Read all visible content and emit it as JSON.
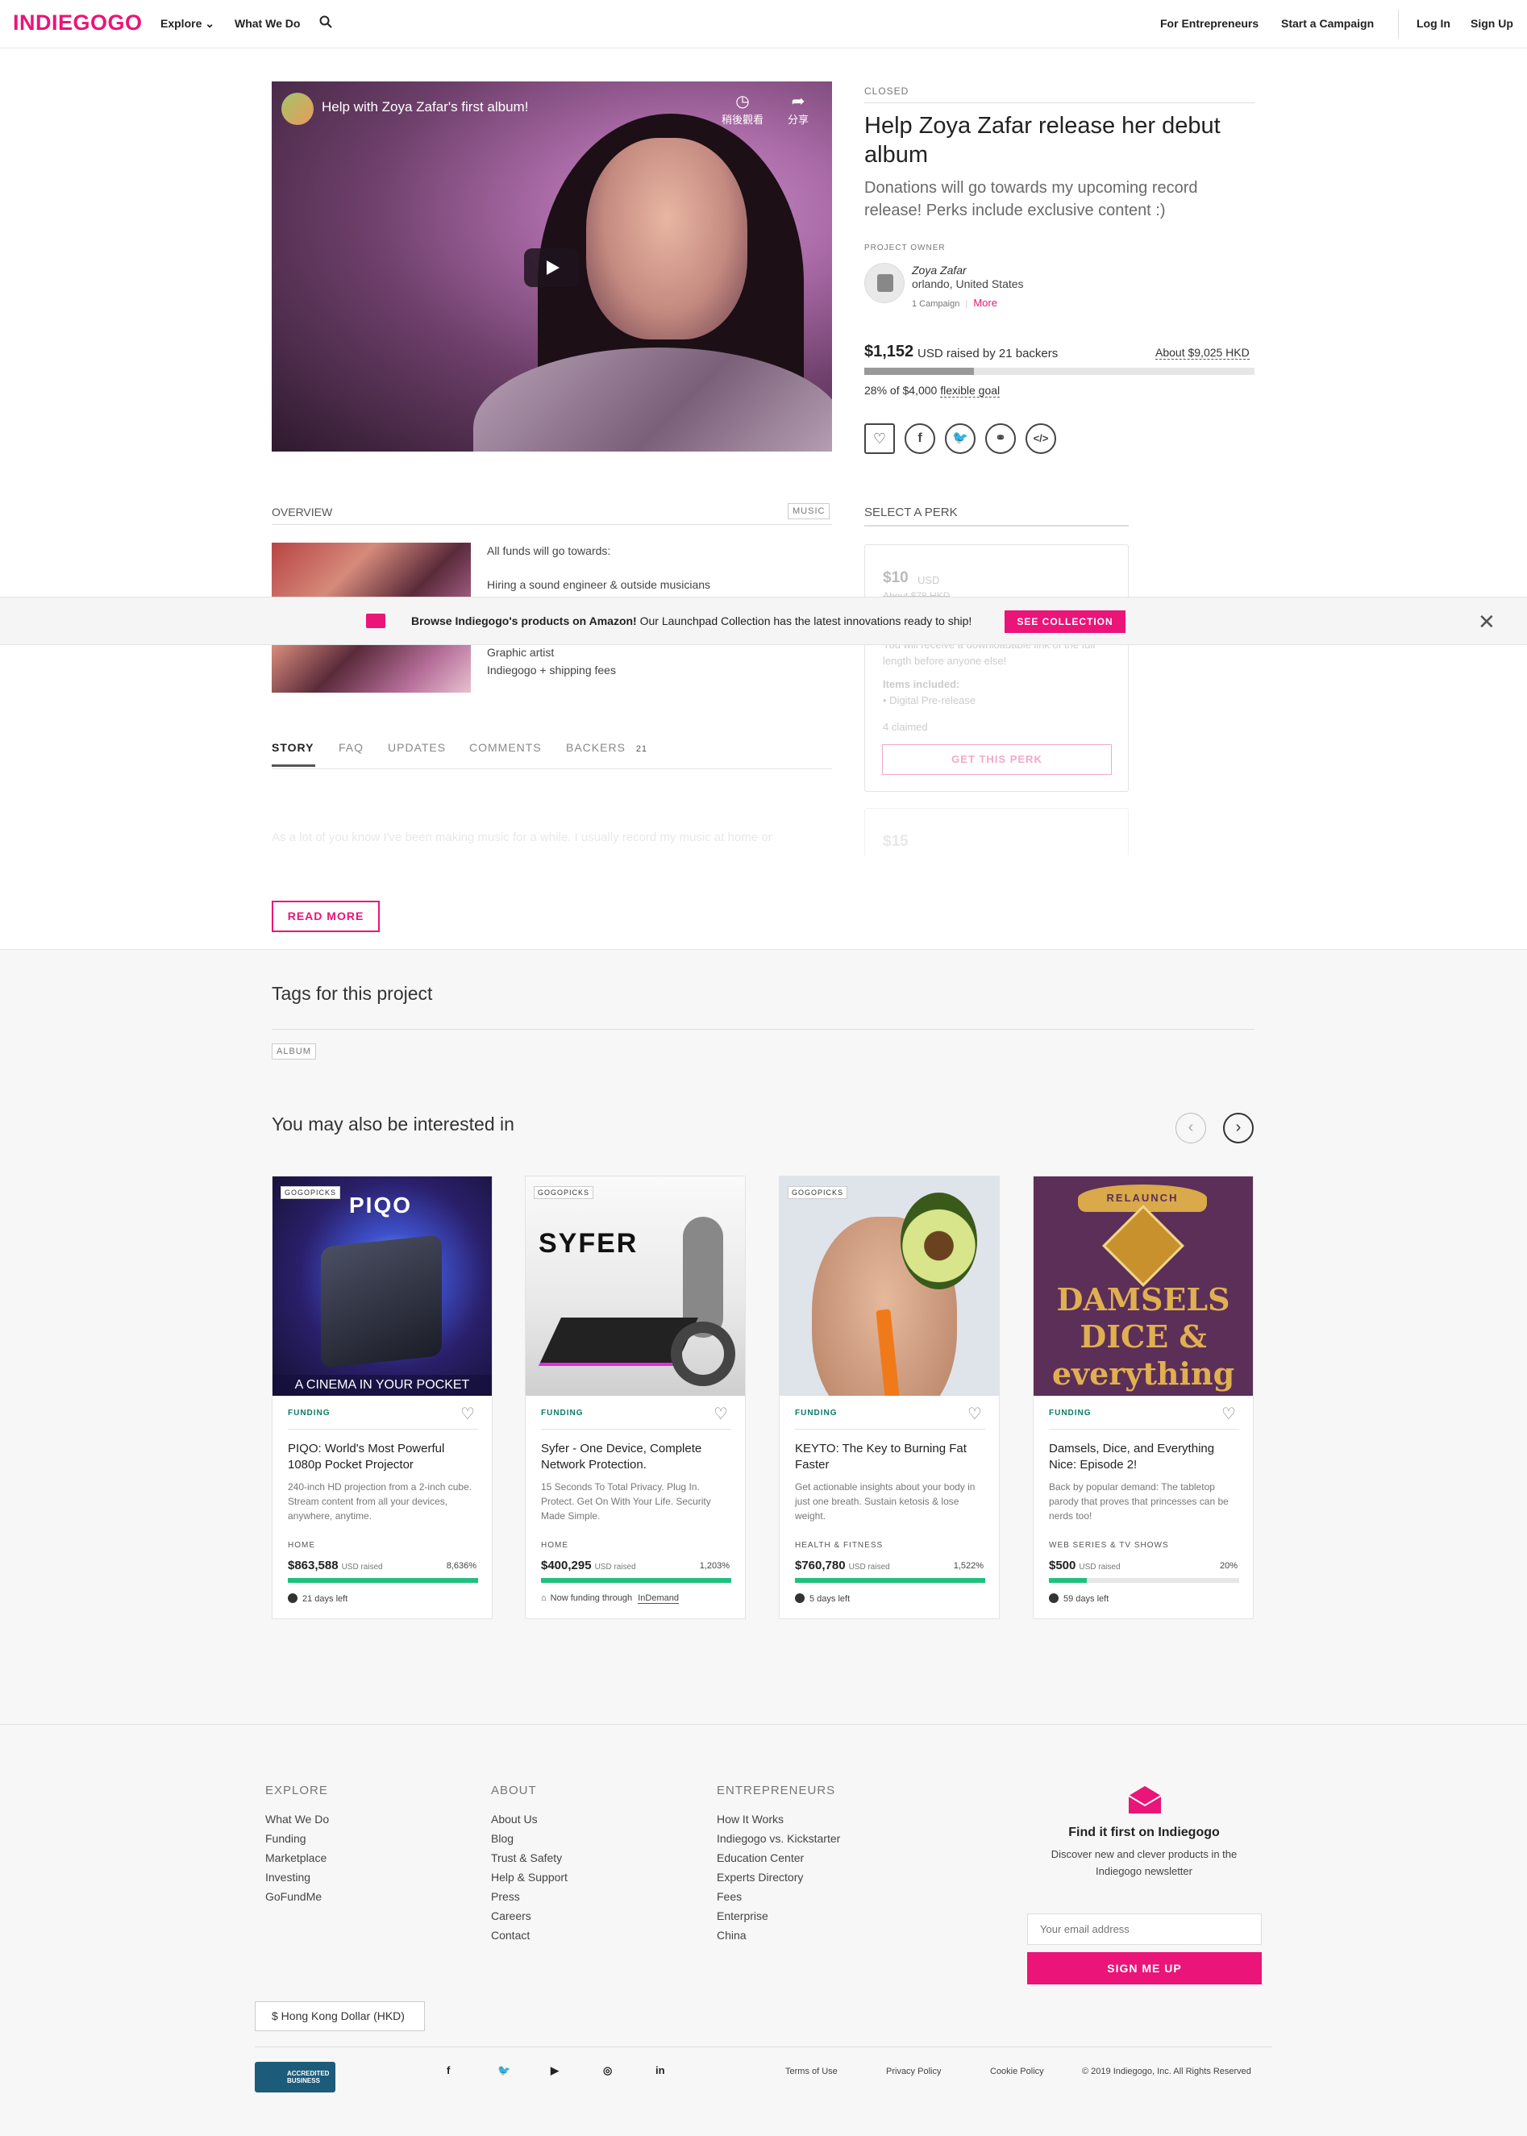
{
  "header": {
    "logo": "INDIEGOGO",
    "nav_left": [
      "Explore ⌄",
      "What We Do"
    ],
    "nav_right": [
      "For Entrepreneurs",
      "Start a Campaign",
      "Log In",
      "Sign Up"
    ]
  },
  "video": {
    "title": "Help with Zoya Zafar's first album!",
    "watch_later": "稍後觀看",
    "share": "分享"
  },
  "campaign": {
    "status": "CLOSED",
    "title": "Help Zoya Zafar release her debut album",
    "tagline": "Donations will go towards my upcoming record release! Perks include exclusive content :)",
    "owner_label": "PROJECT OWNER",
    "owner_name": "Zoya Zafar",
    "owner_location": "orlando, United States",
    "owner_campaigns": "1 Campaign",
    "owner_more": "More",
    "raised": "$1,152",
    "raised_text": "USD raised by 21 backers",
    "local_currency": "About $9,025 HKD",
    "percent_funded": 0.28,
    "goal_text": "28% of $4,000",
    "goal_type": "flexible goal"
  },
  "overview": {
    "label": "OVERVIEW",
    "category_tag": "MUSIC",
    "lines": [
      "All funds will go towards:",
      "Hiring a sound engineer & outside musicians",
      "Graphic artist",
      "Indiegogo + shipping fees"
    ]
  },
  "perk": {
    "label": "SELECT A PERK",
    "price": "$10",
    "currency": "USD",
    "strike": "About $78 HKD",
    "description": "You will receive a downloadable link of the full length before anyone else!",
    "items_label": "Items included:",
    "item": "Digital Pre-release",
    "claimed": "4 claimed",
    "button": "GET THIS PERK",
    "next_price": "$15"
  },
  "banner": {
    "bold": "Browse Indiegogo's products on Amazon!",
    "text": " Our Launchpad Collection has the latest innovations ready to ship!",
    "button": "SEE COLLECTION"
  },
  "tabs": {
    "story": "STORY",
    "faq": "FAQ",
    "updates": "UPDATES",
    "comments": "COMMENTS",
    "backers": "BACKERS",
    "backers_count": "21"
  },
  "story_teaser": "As a lot of you know I've been making music for a while. I usually record my music at home or",
  "read_more": "READ MORE",
  "tags_section": {
    "title": "Tags for this project",
    "tag": "ALBUM"
  },
  "interest": {
    "title": "You may also be interested in",
    "cards": [
      {
        "badge": "GOGOPICKS",
        "image_text": "PIQO",
        "image_caption": "A CINEMA IN YOUR POCKET",
        "status": "FUNDING",
        "title": "PIQO: World's Most Powerful 1080p Pocket Projector",
        "desc": "240-inch HD projection from a 2-inch cube. Stream content from all your devices, anywhere, anytime.",
        "category": "HOME",
        "amount": "$863,588",
        "usd": "USD raised",
        "pct": "8,636%",
        "fill": 1.0,
        "foot": "21 days left"
      },
      {
        "badge": "GOGOPICKS",
        "image_text": "SYFER",
        "status": "FUNDING",
        "title": "Syfer - One Device, Complete Network Protection.",
        "desc": "15 Seconds To Total Privacy. Plug In. Protect. Get On With Your Life. Security Made Simple.",
        "category": "HOME",
        "amount": "$400,295",
        "usd": "USD raised",
        "pct": "1,203%",
        "fill": 1.0,
        "foot": "Now funding through",
        "foot_link": "InDemand"
      },
      {
        "badge": "GOGOPICKS",
        "status": "FUNDING",
        "title": "KEYTO: The Key to Burning Fat Faster",
        "desc": "Get actionable insights about your body in just one breath. Sustain ketosis & lose weight.",
        "category": "HEALTH & FITNESS",
        "amount": "$760,780",
        "usd": "USD raised",
        "pct": "1,522%",
        "fill": 1.0,
        "foot": "5 days left"
      },
      {
        "image_text": "RELAUNCH",
        "image_caption": "DAMSELS DICE & everything Nice",
        "status": "FUNDING",
        "title": "Damsels, Dice, and Everything Nice: Episode 2!",
        "desc": "Back by popular demand: The tabletop parody that proves that princesses can be nerds too!",
        "category": "WEB SERIES & TV SHOWS",
        "amount": "$500",
        "usd": "USD raised",
        "pct": "20%",
        "fill": 0.2,
        "foot": "59 days left"
      }
    ]
  },
  "footer": {
    "explore_head": "EXPLORE",
    "explore": [
      "What We Do",
      "Funding",
      "Marketplace",
      "Investing",
      "GoFundMe"
    ],
    "about_head": "ABOUT",
    "about": [
      "About Us",
      "Blog",
      "Trust & Safety",
      "Help & Support",
      "Press",
      "Careers",
      "Contact"
    ],
    "entre_head": "ENTREPRENEURS",
    "entre": [
      "How It Works",
      "Indiegogo vs. Kickstarter",
      "Education Center",
      "Experts Directory",
      "Fees",
      "Enterprise",
      "China"
    ],
    "newsletter_title": "Find it first on Indiegogo",
    "newsletter_text": "Discover new and clever products in the Indiegogo newsletter",
    "email_placeholder": "Your email address",
    "signup": "SIGN ME UP",
    "currency": "$ Hong Kong Dollar (HKD)",
    "bbb": "ACCREDITED BUSINESS",
    "social": [
      "f",
      "🐦",
      "▶",
      "◎",
      "in"
    ],
    "terms": "Terms of Use",
    "privacy": "Privacy Policy",
    "cookie": "Cookie Policy",
    "copyright": "© 2019 Indiegogo, Inc. All Rights Reserved"
  }
}
